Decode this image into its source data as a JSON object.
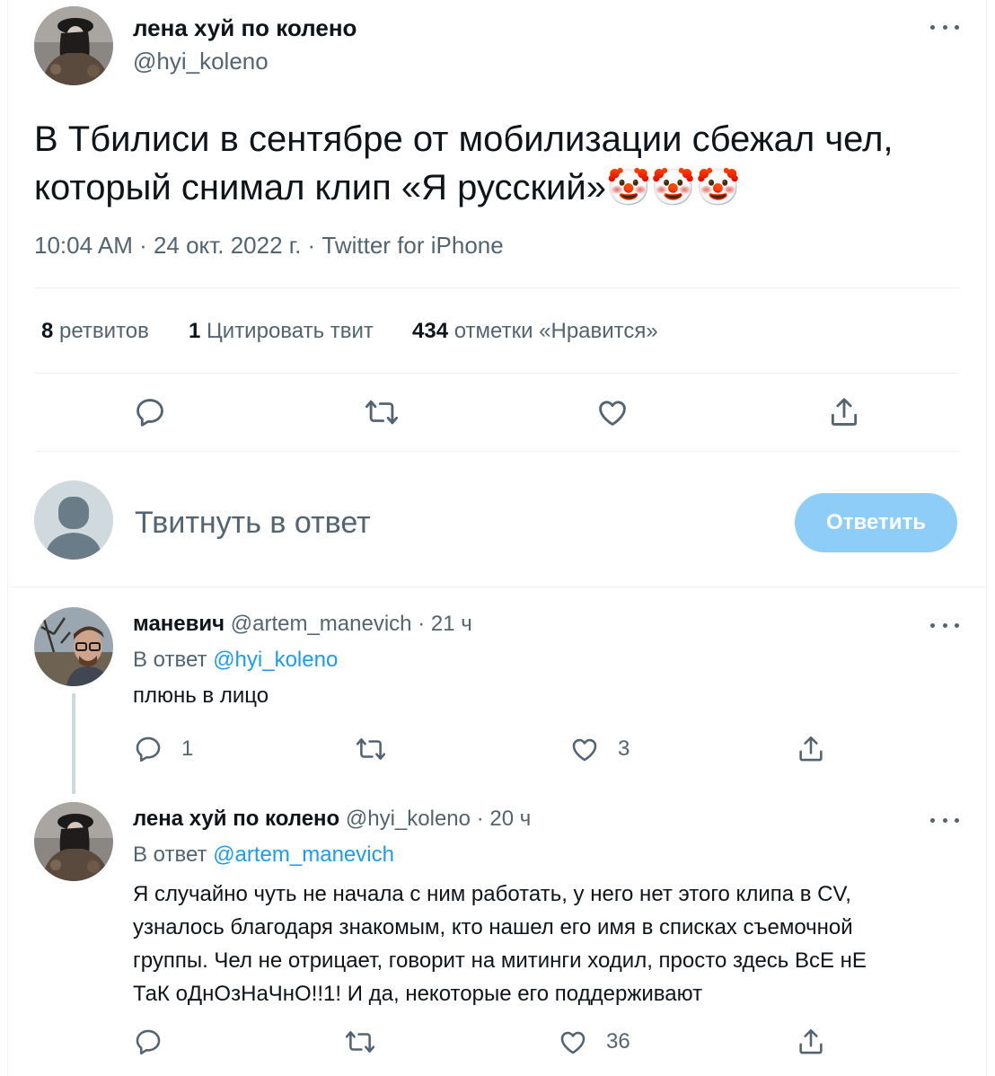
{
  "main_tweet": {
    "display_name": "лена хуй по колено",
    "handle": "@hyi_koleno",
    "text": "В Тбилиси в сентябре от мобилизации сбежал чел, который снимал клип «Я русский»",
    "emoji": "🤡🤡🤡",
    "timestamp": "10:04 AM · 24 окт. 2022 г. · Twitter for iPhone",
    "stats": {
      "retweets_count": "8",
      "retweets_label": "ретвитов",
      "quotes_count": "1",
      "quotes_label": "Цитировать твит",
      "likes_count": "434",
      "likes_label": "отметки «Нравится»"
    }
  },
  "reply_box": {
    "placeholder": "Твитнуть в ответ",
    "button_label": "Ответить"
  },
  "replies": [
    {
      "display_name": "маневич",
      "handle": "@artem_manevich",
      "time": "· 21 ч",
      "reply_to_label": "В ответ",
      "reply_to": "@hyi_koleno",
      "text": "плюнь в лицо",
      "reply_count": "1",
      "retweet_count": "",
      "like_count": "3"
    },
    {
      "display_name": "лена хуй по колено",
      "handle": "@hyi_koleno",
      "time": "· 20 ч",
      "reply_to_label": "В ответ",
      "reply_to": "@artem_manevich",
      "text_lines": [
        "Я случайно чуть не начала с ним работать, у него нет этого клипа в CV,",
        "узналось благодаря знакомым, кто нашел его имя в списках съемочной",
        "группы. Чел не отрицает, говорит на митинги ходил, просто здесь ВсЕ нЕ",
        "ТаК оДнОзНаЧнО!!1! И да, некоторые его поддерживают"
      ],
      "reply_count": "",
      "retweet_count": "",
      "like_count": "36"
    }
  ],
  "colors": {
    "text": "#0f1419",
    "secondary": "#536471",
    "accent": "#1d9bf0",
    "button_disabled": "#8ecdf8",
    "divider": "#eff3f4"
  }
}
